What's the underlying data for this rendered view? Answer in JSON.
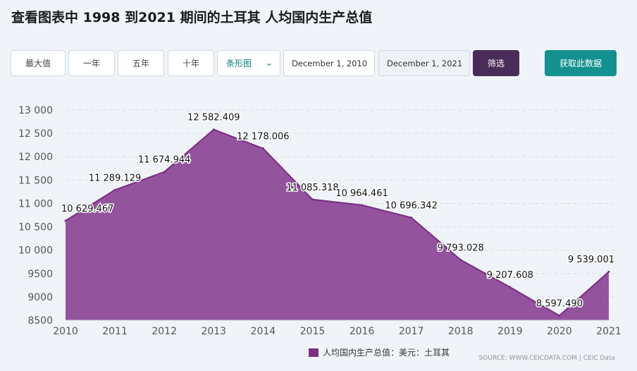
{
  "title": "查看图表中 1998 到2021 期间的土耳其 人均国内生产总值",
  "controls": {
    "ranges": [
      "最大值",
      "一年",
      "五年",
      "十年"
    ],
    "chart_type": "条形图",
    "start_date": "December 1, 2010",
    "end_date": "December 1, 2021",
    "filter_label": "筛选",
    "get_data_label": "获取此数据"
  },
  "legend_label": "人均国内生产总值：美元：土耳其",
  "source": "SOURCE: WWW.CEICDATA.COM | CEIC Data",
  "colors": {
    "area_fill": "#8e4a98",
    "area_line": "#7b2d86",
    "accent_teal": "#14918f",
    "filter": "#4a2c5a"
  },
  "chart_data": {
    "type": "area",
    "x": [
      2010,
      2011,
      2012,
      2013,
      2014,
      2015,
      2016,
      2017,
      2018,
      2019,
      2020,
      2021
    ],
    "values": [
      10629.467,
      11289.129,
      11674.944,
      12582.409,
      12178.006,
      11085.318,
      10964.461,
      10696.342,
      9793.028,
      9207.608,
      8597.49,
      9539.001
    ],
    "value_labels": [
      "10 629.467",
      "11 289.129",
      "11 674.944",
      "12 582.409",
      "12 178.006",
      "11 085.318",
      "10 964.461",
      "10 696.342",
      "9 793.028",
      "9 207.608",
      "8 597.490",
      "9 539.001"
    ],
    "ylim": [
      8500,
      13000
    ],
    "y_ticks": [
      8500,
      9000,
      9500,
      10000,
      10500,
      11000,
      11500,
      12000,
      12500,
      13000
    ],
    "y_tick_labels": [
      "8500",
      "9000",
      "9500",
      "10 000",
      "10 500",
      "11 000",
      "11 500",
      "12 000",
      "12 500",
      "13 000"
    ],
    "x_tick_labels": [
      "2010",
      "2011",
      "2012",
      "2013",
      "2014",
      "2015",
      "2016",
      "2017",
      "2018",
      "2019",
      "2020",
      "2021"
    ],
    "grid": true,
    "legend_position": "bottom",
    "series": [
      {
        "name": "人均国内生产总值：美元：土耳其"
      }
    ]
  }
}
